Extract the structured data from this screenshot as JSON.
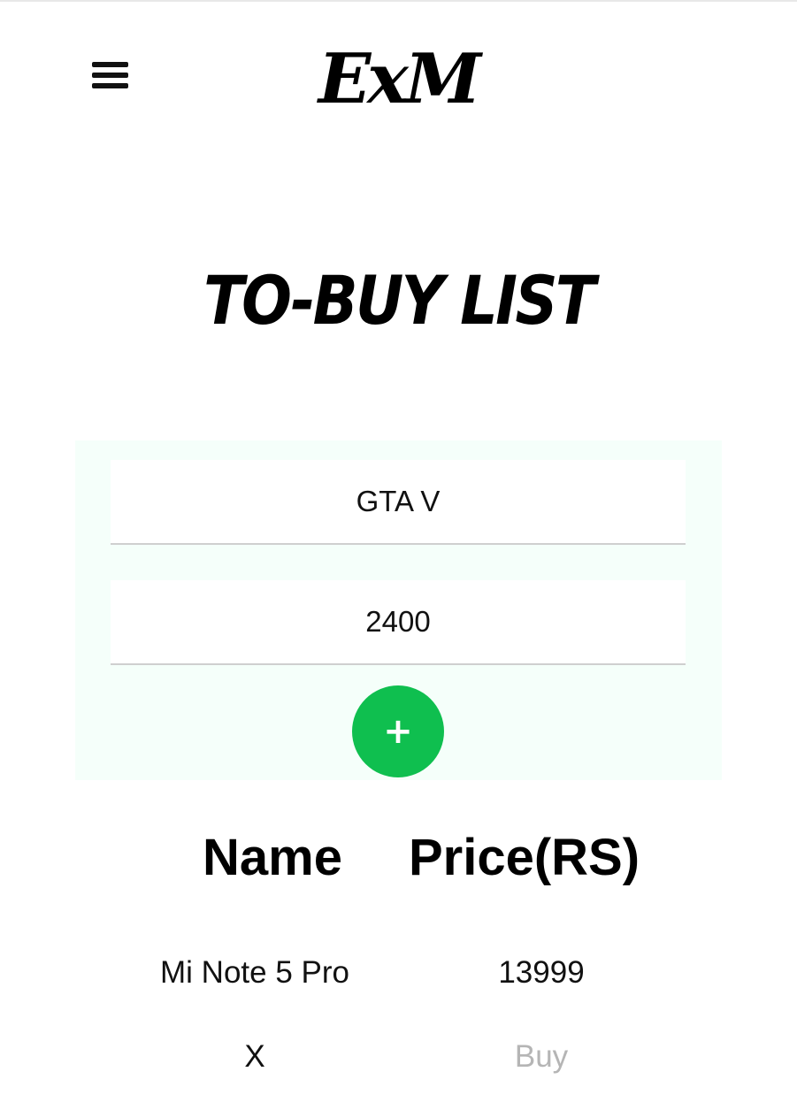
{
  "header": {
    "logo_text": "ExM",
    "menu_icon": "hamburger-menu-icon"
  },
  "main": {
    "title": "TO-BUY LIST"
  },
  "form": {
    "name_value": "GTA V",
    "price_value": "2400",
    "add_label": "+",
    "accent_color": "#0fbf4f",
    "panel_color": "#f5fffa"
  },
  "table": {
    "headers": [
      "Name",
      "Price(RS)"
    ],
    "rows": [
      {
        "name": "Mi Note 5 Pro",
        "price": "13999",
        "remove_label": "X",
        "buy_label": "Buy"
      }
    ]
  }
}
